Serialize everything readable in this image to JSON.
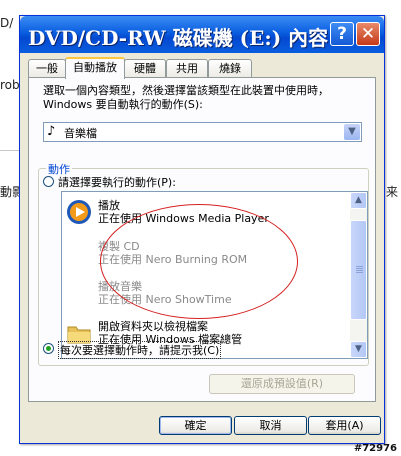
{
  "background": {
    "fragment_top": "D/",
    "fragment_left1": "rob",
    "fragment_left2": "動影",
    "fragment_right": "来"
  },
  "watermark": "#72976",
  "dialog": {
    "title": "DVD/CD-RW 磁碟機 (E:) 內容",
    "help_glyph": "?",
    "close_glyph": "✕",
    "tabs": [
      {
        "label": "一般",
        "active": false
      },
      {
        "label": "自動播放",
        "active": true
      },
      {
        "label": "硬體",
        "active": false
      },
      {
        "label": "共用",
        "active": false
      },
      {
        "label": "燒錄",
        "active": false
      }
    ],
    "prompt_line1": "選取一個內容類型，然後選擇當該類型在此裝置中使用時，",
    "prompt_line2": "Windows 要自動執行的動作(S):",
    "content_type": {
      "icon": "music-file-icon",
      "value": "音樂檔"
    },
    "actions_group_label": "動作",
    "select_action_label": "請選擇要執行的動作(P):",
    "actions": [
      {
        "title": "播放",
        "subtitle": "正在使用 Windows Media Player",
        "icon": "windows-media-player-icon",
        "enabled": true
      },
      {
        "title": "複製 CD",
        "subtitle": "正在使用 Nero Burning ROM",
        "icon": "",
        "enabled": false
      },
      {
        "title": "播放音樂",
        "subtitle": "正在使用 Nero ShowTime",
        "icon": "",
        "enabled": false
      },
      {
        "title": "開啟資料夾以檢視檔案",
        "subtitle": "正在使用 Windows 檔案總管",
        "icon": "folder-icon",
        "enabled": true
      }
    ],
    "prompt_each_time_label": "每次要選擇動作時，請提示我(C)",
    "restore_defaults_label": "還原成預設值(R)",
    "ok_label": "確定",
    "cancel_label": "取消",
    "apply_label": "套用(A)",
    "annotation_color": "#d62020",
    "accent_color": "#0a5ee0"
  }
}
